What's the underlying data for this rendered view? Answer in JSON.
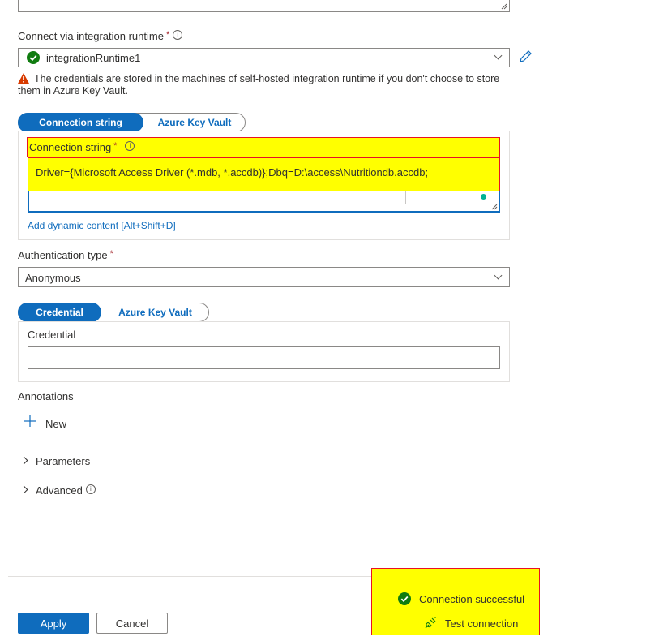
{
  "runtime": {
    "label": "Connect via integration runtime",
    "required_mark": "*",
    "info_mark": "i",
    "selected": "integrationRuntime1",
    "warning": "The credentials are stored in the machines of self-hosted integration runtime if you don't choose to store them in Azure Key Vault."
  },
  "conn_toggle": {
    "active": "Connection string",
    "inactive": "Azure Key Vault"
  },
  "connection": {
    "label": "Connection string",
    "required_mark": "*",
    "info_mark": "i",
    "value": "Driver={Microsoft Access Driver (*.mdb, *.accdb)};Dbq=D:\\access\\Nutritiondb.accdb;",
    "dynamic_link": "Add dynamic content [Alt+Shift+D]"
  },
  "auth": {
    "label": "Authentication type",
    "required_mark": "*",
    "selected": "Anonymous"
  },
  "cred_toggle": {
    "active": "Credential",
    "inactive": "Azure Key Vault"
  },
  "credential": {
    "label": "Credential",
    "value": ""
  },
  "annotations": {
    "label": "Annotations",
    "new_label": "New"
  },
  "sections": {
    "parameters": "Parameters",
    "advanced": "Advanced",
    "info_mark": "i"
  },
  "footer": {
    "apply": "Apply",
    "cancel": "Cancel",
    "status": "Connection successful",
    "test": "Test connection"
  },
  "colors": {
    "accent": "#0f6cbd",
    "success": "#107c10",
    "warning": "#d83b01",
    "highlight": "#ffff00"
  }
}
